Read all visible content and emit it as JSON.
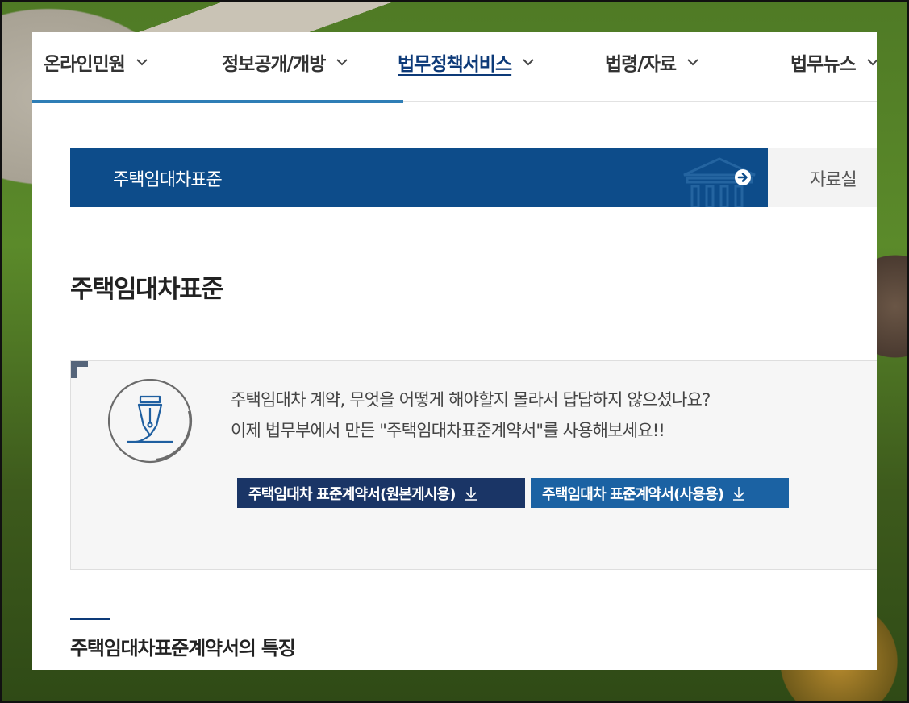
{
  "nav": {
    "items": [
      {
        "label": "온라인민원"
      },
      {
        "label": "정보공개/개방"
      },
      {
        "label": "법무정책서비스"
      },
      {
        "label": "법령/자료"
      },
      {
        "label": "법무뉴스"
      }
    ]
  },
  "breadcrumb": {
    "current": "주택임대차표준",
    "next": "자료실"
  },
  "page": {
    "title": "주택임대차표준"
  },
  "info": {
    "line1": "주택임대차 계약, 무엇을 어떻게 해야할지 몰라서 답답하지 않으셨나요?",
    "line2": "이제 법무부에서 만든 \"주택임대차표준계약서\"를 사용해보세요!!",
    "buttons": [
      {
        "label": "주택임대차 표준계약서(원본게시용)"
      },
      {
        "label": "주택임대차 표준계약서(사용용)"
      }
    ]
  },
  "section": {
    "title": "주택임대차표준계약서의 특징"
  },
  "colors": {
    "nav_active": "#0d3a78",
    "nav_bar": "#2f7eb6",
    "banner": "#0d4c8a",
    "btn_dark": "#1a3566",
    "btn_blue": "#1b62a3"
  }
}
